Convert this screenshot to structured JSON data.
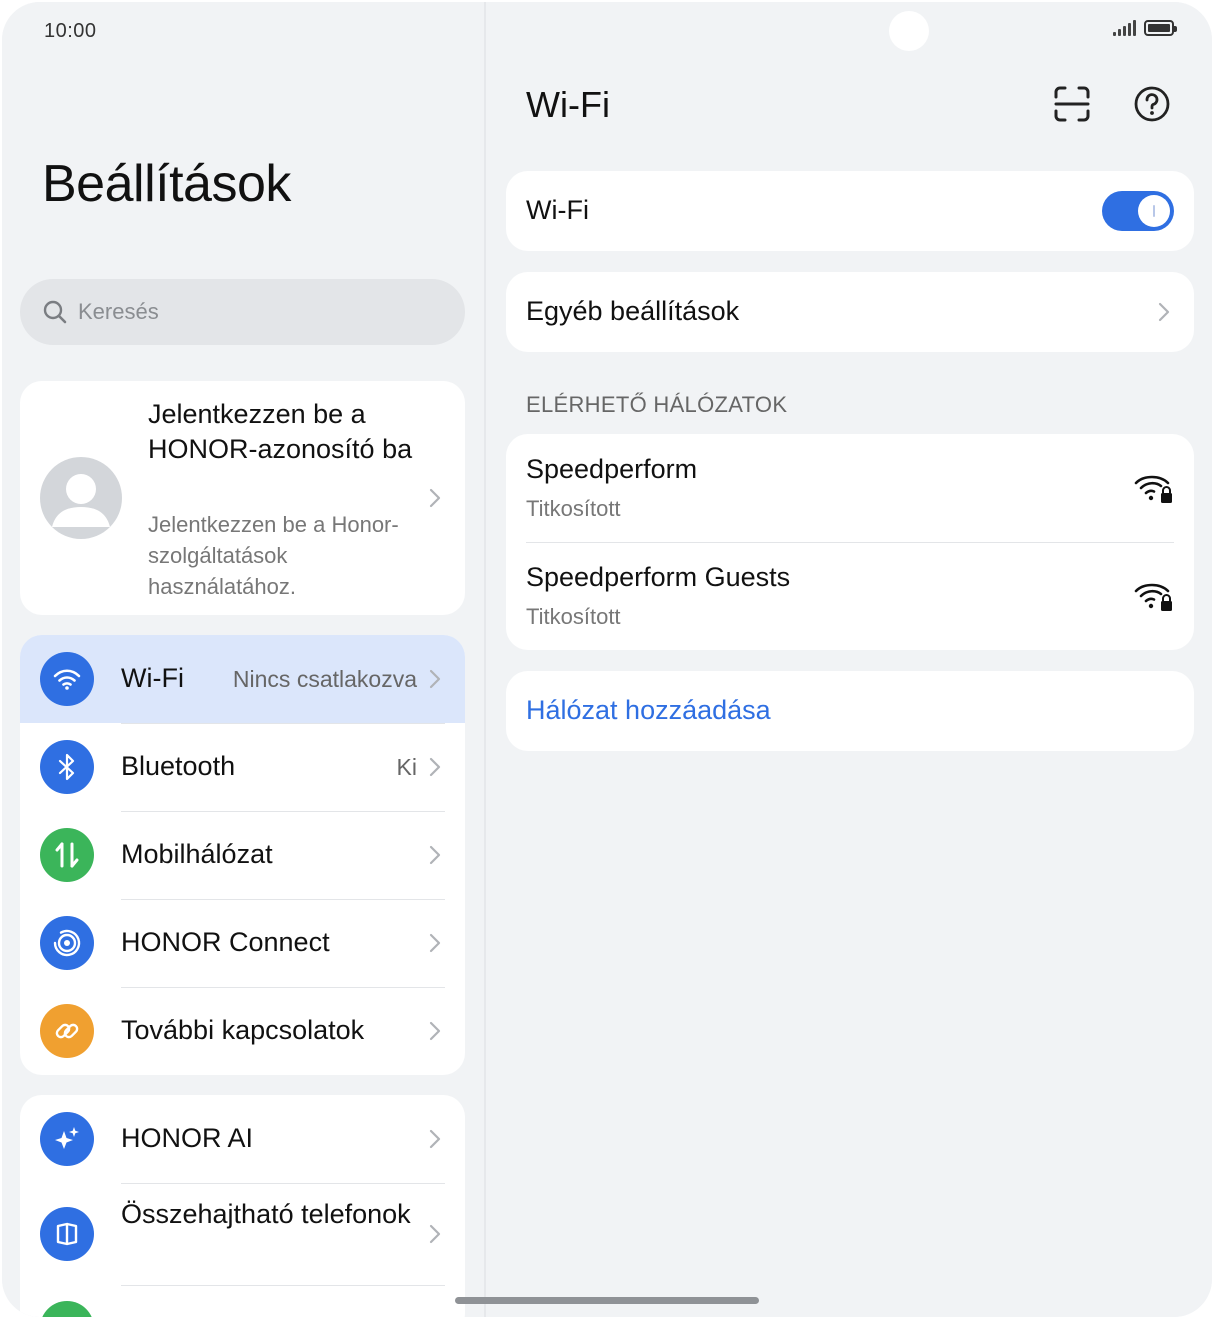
{
  "status_bar": {
    "time": "10:00"
  },
  "left": {
    "title": "Beállítások",
    "search": {
      "placeholder": "Keresés"
    },
    "account": {
      "title": "Jelentkezzen be a HONOR-azonosító ba",
      "subtitle": "Jelentkezzen be a Honor-szolgáltatások használatához."
    },
    "connectivity": [
      {
        "label": "Wi-Fi",
        "value": "Nincs csatlakozva",
        "icon": "wifi-icon",
        "color": "#2f6fe2",
        "active": true
      },
      {
        "label": "Bluetooth",
        "value": "Ki",
        "icon": "bluetooth-icon",
        "color": "#2f6fe2",
        "active": false
      },
      {
        "label": "Mobilhálózat",
        "value": "",
        "icon": "mobile-data-icon",
        "color": "#3bb55a",
        "active": false
      },
      {
        "label": "HONOR Connect",
        "value": "",
        "icon": "honor-connect-icon",
        "color": "#2f6fe2",
        "active": false
      },
      {
        "label": "További kapcsolatok",
        "value": "",
        "icon": "link-icon",
        "color": "#f0a030",
        "active": false
      }
    ],
    "more": [
      {
        "label": "HONOR AI",
        "icon": "ai-sparkle-icon",
        "color": "#2f6fe2"
      },
      {
        "label": "Összehajtható telefonok",
        "icon": "foldable-icon",
        "color": "#2f6fe2"
      }
    ]
  },
  "right": {
    "title": "Wi-Fi",
    "wifi_toggle": {
      "label": "Wi-Fi",
      "on": true
    },
    "other_settings": "Egyéb beállítások",
    "section_header": "ELÉRHETŐ HÁLÓZATOK",
    "networks": [
      {
        "name": "Speedperform",
        "security": "Titkosított",
        "icon": "wifi-locked-icon"
      },
      {
        "name": "Speedperform Guests",
        "security": "Titkosított",
        "icon": "wifi-locked-icon"
      }
    ],
    "add_network": "Hálózat hozzáadása"
  },
  "colors": {
    "accent": "#2f6fe2",
    "background": "#f1f3f5",
    "active_row": "#dbe6fb"
  }
}
